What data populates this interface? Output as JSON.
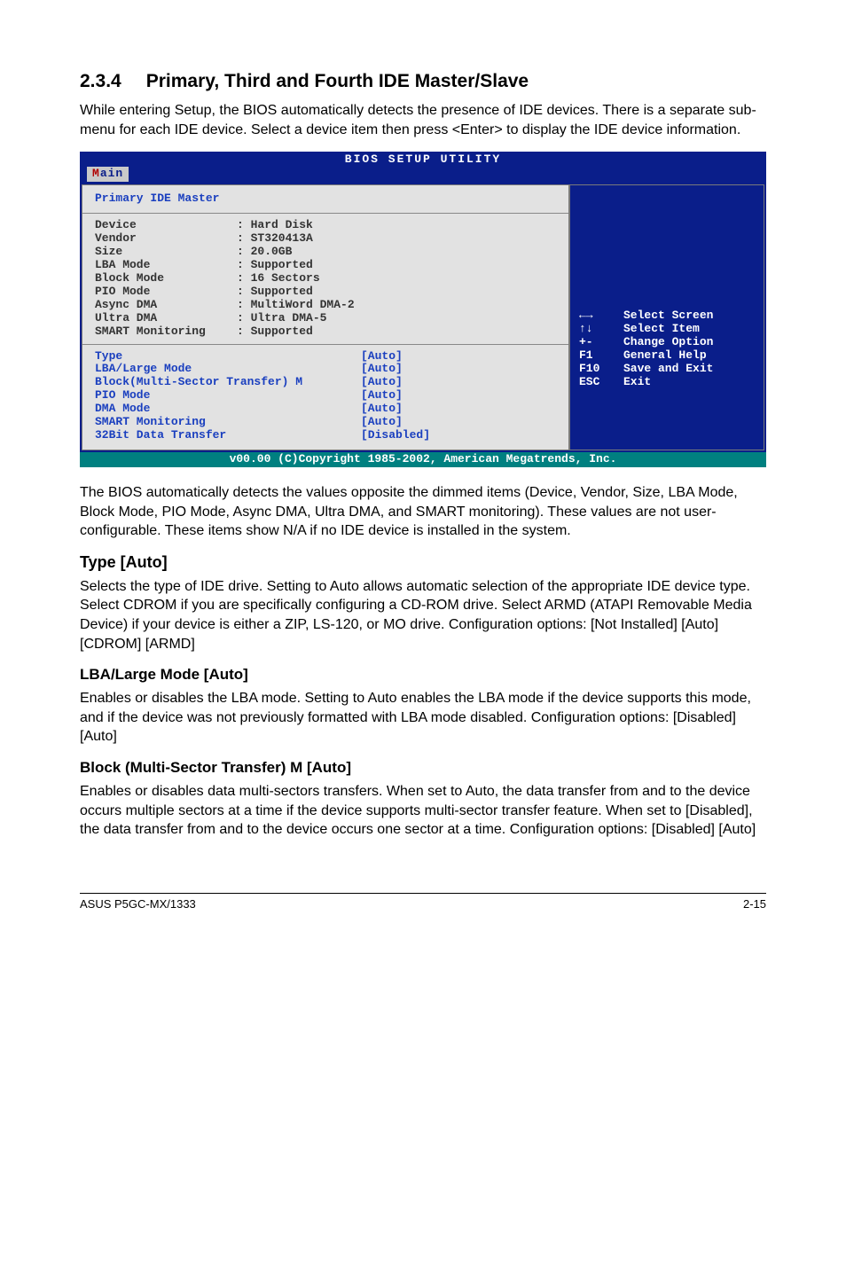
{
  "section": {
    "number": "2.3.4",
    "title": "Primary, Third and Fourth IDE Master/Slave"
  },
  "intro": "While entering Setup, the BIOS automatically detects the presence of IDE devices. There is a separate sub-menu for each IDE device. Select a device item then press <Enter> to display the IDE device information.",
  "bios": {
    "title": "BIOS SETUP UTILITY",
    "tab_prefix": "M",
    "tab_rest": "ain",
    "panel_title": "Primary IDE Master",
    "detected": [
      {
        "k": "Device",
        "v": ": Hard Disk"
      },
      {
        "k": "Vendor",
        "v": ": ST320413A"
      },
      {
        "k": "Size",
        "v": ": 20.0GB"
      },
      {
        "k": "LBA Mode",
        "v": ": Supported"
      },
      {
        "k": "Block Mode",
        "v": ": 16 Sectors"
      },
      {
        "k": "PIO Mode",
        "v": ": Supported"
      },
      {
        "k": "Async DMA",
        "v": ": MultiWord DMA-2"
      },
      {
        "k": "Ultra DMA",
        "v": ": Ultra DMA-5"
      },
      {
        "k": "SMART Monitoring",
        "v": ": Supported",
        "nocolon_gap": true
      }
    ],
    "options": [
      {
        "k": "Type",
        "v": "[Auto]"
      },
      {
        "k": "LBA/Large Mode",
        "v": "[Auto]"
      },
      {
        "k": "Block(Multi-Sector Transfer) M",
        "v": "[Auto]"
      },
      {
        "k": "PIO Mode",
        "v": "[Auto]"
      },
      {
        "k": "DMA Mode",
        "v": "[Auto]"
      },
      {
        "k": "SMART Monitoring",
        "v": "[Auto]"
      },
      {
        "k": "32Bit Data Transfer",
        "v": "[Disabled]"
      }
    ],
    "help": [
      {
        "sym": "←→",
        "label": "Select Screen"
      },
      {
        "sym": "↑↓",
        "label": "Select Item"
      },
      {
        "sym": "+-",
        "label": "Change Option"
      },
      {
        "sym": "F1",
        "label": "General Help"
      },
      {
        "sym": "F10",
        "label": "Save and Exit"
      },
      {
        "sym": "ESC",
        "label": "Exit"
      }
    ],
    "footer": "v00.00 (C)Copyright 1985-2002, American Megatrends, Inc."
  },
  "after_bios": "The BIOS automatically detects the values opposite the dimmed items (Device, Vendor, Size, LBA Mode, Block Mode, PIO Mode, Async DMA, Ultra DMA, and SMART monitoring). These values are not user-configurable. These items show N/A if no IDE device is installed in the system.",
  "type_section": {
    "heading": "Type [Auto]",
    "body": "Selects the type of IDE drive. Setting to Auto allows automatic selection of the appropriate IDE device type. Select CDROM if you are specifically configuring a CD-ROM drive. Select ARMD (ATAPI Removable Media Device) if your device is either a ZIP, LS-120, or MO drive. Configuration options: [Not Installed] [Auto] [CDROM] [ARMD]"
  },
  "lba_section": {
    "heading": "LBA/Large Mode [Auto]",
    "body": "Enables or disables the LBA mode. Setting to Auto enables the LBA mode if the device supports this mode, and if the device was not previously formatted with LBA mode disabled. Configuration options: [Disabled] [Auto]"
  },
  "block_section": {
    "heading": "Block (Multi-Sector Transfer) M [Auto]",
    "body": "Enables or disables data multi-sectors transfers. When set to Auto, the data transfer from and to the device occurs multiple sectors at a time if the device supports multi-sector transfer feature. When set to [Disabled], the data transfer from and to the device occurs one sector at a time. Configuration options: [Disabled] [Auto]"
  },
  "footer": {
    "left": "ASUS P5GC-MX/1333",
    "right": "2-15"
  }
}
